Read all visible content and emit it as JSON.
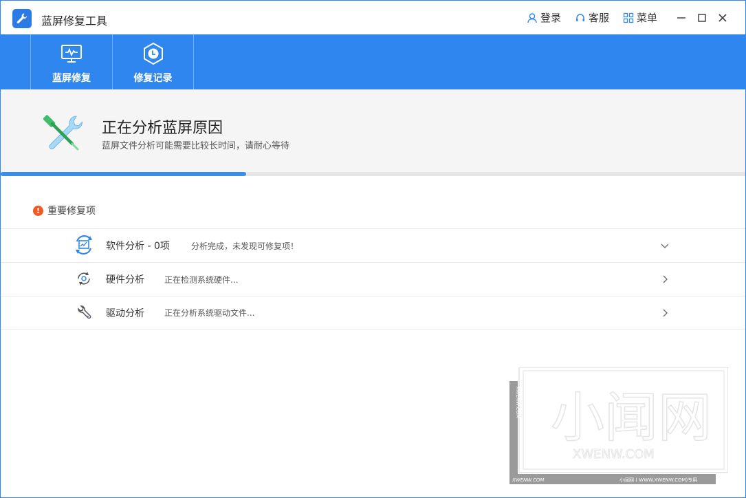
{
  "app": {
    "title": "蓝屏修复工具",
    "accent": "#2f86ee"
  },
  "titlebar": {
    "login_label": "登录",
    "service_label": "客服",
    "menu_label": "菜单"
  },
  "toolbar": {
    "tabs": [
      {
        "label": "蓝屏修复",
        "icon": "monitor-pulse-icon"
      },
      {
        "label": "修复记录",
        "icon": "clock-hexagon-icon"
      }
    ]
  },
  "status": {
    "title": "正在分析蓝屏原因",
    "subtitle": "蓝屏文件分析可能需要比较长时间，请耐心等待",
    "progress": 0.33
  },
  "section": {
    "title": "重要修复项",
    "alert_glyph": "!"
  },
  "items": [
    {
      "name": "软件分析 - 0项",
      "status": "分析完成，未发现可修复项！",
      "icon": "software-analysis-icon",
      "chevron": "down"
    },
    {
      "name": "硬件分析",
      "status": "正在检测系统硬件...",
      "icon": "hardware-refresh-icon",
      "chevron": "right"
    },
    {
      "name": "驱动分析",
      "status": "正在分析系统驱动文件...",
      "icon": "driver-wrench-icon",
      "chevron": "right"
    }
  ],
  "watermark": {
    "cn": "小闻网",
    "en": "XWENW.COM",
    "side": "XWENW.COM",
    "bottom_left": "XWENW.COM",
    "bottom_right": "小闻网 ( WWW.XWENW.COM)专用"
  }
}
